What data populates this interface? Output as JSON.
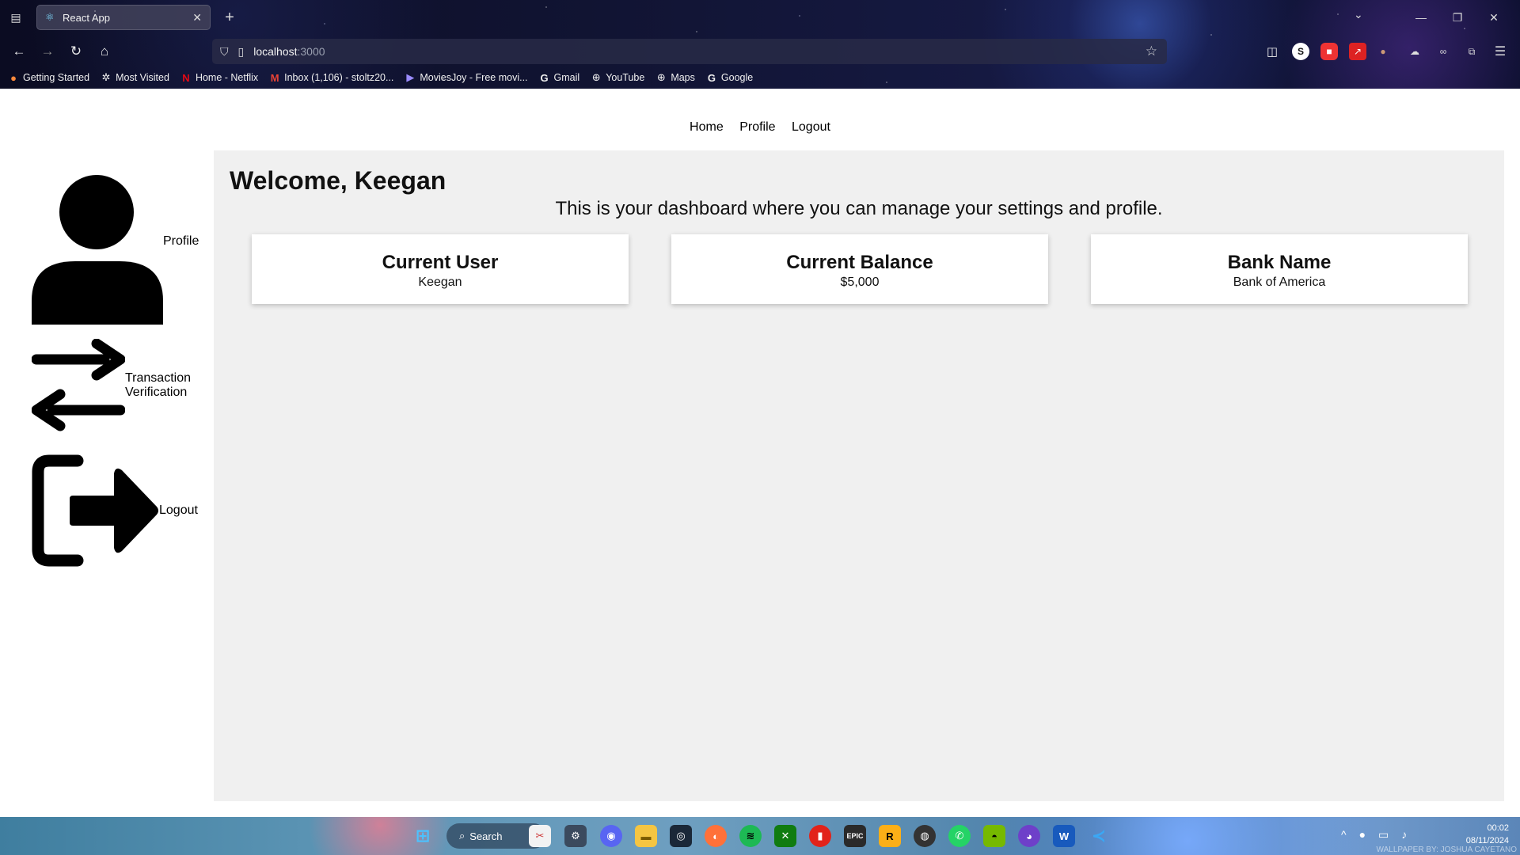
{
  "browser": {
    "tab_title": "React App",
    "url_host": "localhost",
    "url_port": ":3000",
    "bookmarks": [
      {
        "label": "Getting Started",
        "icon": "firefox-icon"
      },
      {
        "label": "Most Visited",
        "icon": "gear-icon"
      },
      {
        "label": "Home - Netflix",
        "icon": "netflix-icon"
      },
      {
        "label": "Inbox (1,106) - stoltz20...",
        "icon": "gmail-icon"
      },
      {
        "label": "MoviesJoy - Free movi...",
        "icon": "moviesjoy-icon"
      },
      {
        "label": "Gmail",
        "icon": "google-icon"
      },
      {
        "label": "YouTube",
        "icon": "globe-icon"
      },
      {
        "label": "Maps",
        "icon": "globe-icon"
      },
      {
        "label": "Google",
        "icon": "google-icon"
      }
    ]
  },
  "nav": {
    "home": "Home",
    "profile": "Profile",
    "logout": "Logout"
  },
  "sidebar": {
    "profile": "Profile",
    "transaction_line1": "Transaction",
    "transaction_line2": "Verification",
    "logout": "Logout"
  },
  "dashboard": {
    "welcome": "Welcome, Keegan",
    "subtitle": "This is your dashboard where you can manage your settings and profile.",
    "cards": [
      {
        "title": "Current User",
        "value": "Keegan"
      },
      {
        "title": "Current Balance",
        "value": "$5,000"
      },
      {
        "title": "Bank Name",
        "value": "Bank of America"
      }
    ]
  },
  "taskbar": {
    "search_label": "Search",
    "time": "00:02",
    "date": "08/11/2024",
    "wallpaper_credit": "WALLPAPER BY: JOSHUA CAYETANO"
  },
  "colors": {
    "content_bg": "#f0f0f0",
    "text": "#111111"
  }
}
